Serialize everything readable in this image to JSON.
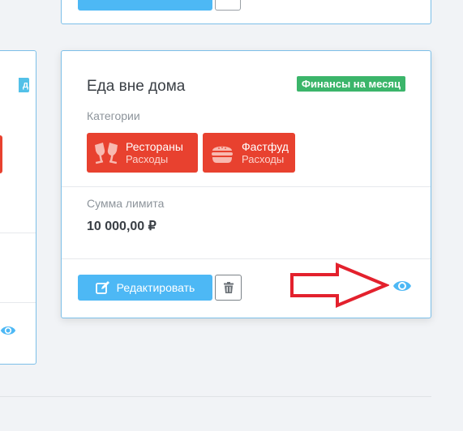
{
  "main_card": {
    "title": "Еда вне дома",
    "badge": "Финансы на месяц",
    "categories_label": "Категории",
    "categories": [
      {
        "name": "Рестораны",
        "type": "Расходы",
        "icon": "cheers-glasses-icon"
      },
      {
        "name": "Фастфуд",
        "type": "Расходы",
        "icon": "burger-icon"
      }
    ],
    "limit_label": "Сумма лимита",
    "limit_value": "10 000,00 ₽",
    "edit_label": "Редактировать"
  },
  "left_card": {
    "badge_fragment": "д"
  },
  "colors": {
    "accent": "#4db8f5",
    "badge_green": "#3bb56a",
    "chip_red": "#e8412f",
    "arrow_red": "#e3212d",
    "card_border": "#7cbfe8"
  }
}
